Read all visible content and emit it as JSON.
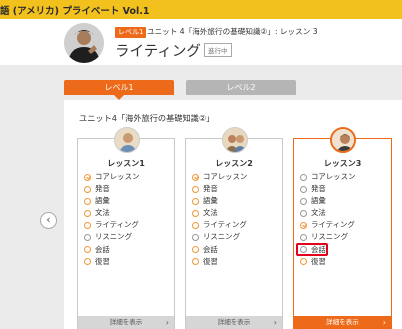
{
  "topbar": {
    "title": "語 (アメリカ) プライベート Vol.1"
  },
  "header": {
    "level_badge": "レベル1",
    "unit_line": "ユニット 4「海外旅行の基礎知識②」: レッスン 3",
    "title": "ライティング",
    "status": "進行中"
  },
  "tabs": [
    {
      "label": "レベル1",
      "state": "active"
    },
    {
      "label": "レベル2",
      "state": "inactive"
    }
  ],
  "unit_heading": "ユニット4「海外旅行の基礎知識②」",
  "lessons": [
    {
      "title": "レッスン1",
      "items": [
        "コアレッスン",
        "発音",
        "語彙",
        "文法",
        "ライティング",
        "リスニング",
        "会話",
        "復習"
      ],
      "item_status": [
        "check",
        "done",
        "done",
        "done",
        "done",
        "pending",
        "done",
        "done"
      ],
      "detail": "詳細を表示"
    },
    {
      "title": "レッスン2",
      "items": [
        "コアレッスン",
        "発音",
        "語彙",
        "文法",
        "ライティング",
        "リスニング",
        "会話",
        "復習"
      ],
      "item_status": [
        "check",
        "done",
        "done",
        "done",
        "done",
        "pending",
        "done",
        "done"
      ],
      "detail": "詳細を表示"
    },
    {
      "title": "レッスン3",
      "items": [
        "コアレッスン",
        "発音",
        "語彙",
        "文法",
        "ライティング",
        "リスニング",
        "会話",
        "復習"
      ],
      "item_status": [
        "pending",
        "pending",
        "pending",
        "pending",
        "check",
        "pending",
        "pending",
        "done"
      ],
      "detail": "詳細を表示"
    }
  ],
  "nav": {
    "prev": "‹",
    "next": "›"
  },
  "colors": {
    "accent": "#ee6a1b",
    "topbar": "#f2c11d",
    "highlight": "#e2001a"
  }
}
